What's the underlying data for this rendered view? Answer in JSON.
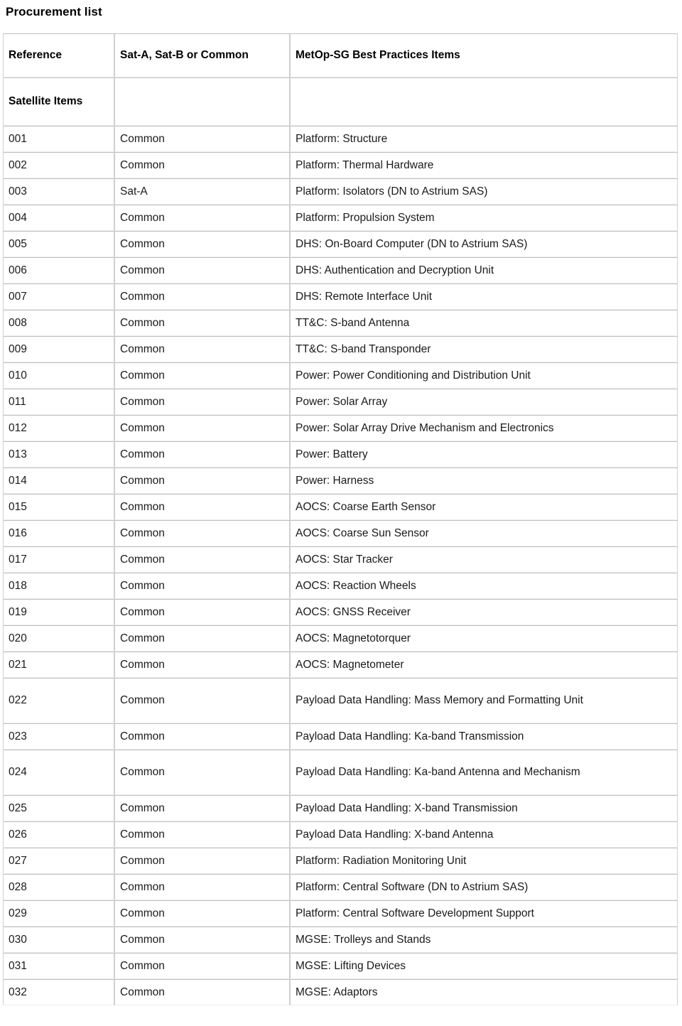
{
  "document": {
    "title": "Procurement list"
  },
  "table": {
    "headers": {
      "reference": "Reference",
      "sat_or_common": "Sat-A, Sat-B or Common",
      "items": "MetOp-SG Best Practices Items"
    },
    "subheader": {
      "reference": "Satellite Items",
      "sat_or_common": "",
      "items": ""
    },
    "columns": [
      "Reference",
      "Sat-A, Sat-B or Common",
      "MetOp-SG Best Practices Items"
    ],
    "rows": [
      {
        "ref": "001",
        "sat": "Common",
        "item": "Platform: Structure"
      },
      {
        "ref": "002",
        "sat": "Common",
        "item": "Platform: Thermal Hardware"
      },
      {
        "ref": "003",
        "sat": "Sat-A",
        "item": "Platform: Isolators (DN to Astrium SAS)"
      },
      {
        "ref": "004",
        "sat": "Common",
        "item": "Platform: Propulsion System"
      },
      {
        "ref": "005",
        "sat": "Common",
        "item": "DHS: On-Board Computer (DN to Astrium SAS)"
      },
      {
        "ref": "006",
        "sat": "Common",
        "item": "DHS: Authentication and Decryption Unit"
      },
      {
        "ref": "007",
        "sat": "Common",
        "item": "DHS: Remote Interface Unit"
      },
      {
        "ref": "008",
        "sat": "Common",
        "item": "TT&C: S-band Antenna"
      },
      {
        "ref": "009",
        "sat": "Common",
        "item": "TT&C: S-band Transponder"
      },
      {
        "ref": "010",
        "sat": "Common",
        "item": "Power: Power Conditioning and Distribution Unit"
      },
      {
        "ref": "011",
        "sat": "Common",
        "item": "Power: Solar Array"
      },
      {
        "ref": "012",
        "sat": "Common",
        "item": "Power: Solar Array Drive Mechanism and Electronics"
      },
      {
        "ref": "013",
        "sat": "Common",
        "item": "Power: Battery"
      },
      {
        "ref": "014",
        "sat": "Common",
        "item": "Power: Harness"
      },
      {
        "ref": "015",
        "sat": "Common",
        "item": "AOCS: Coarse Earth Sensor"
      },
      {
        "ref": "016",
        "sat": "Common",
        "item": "AOCS: Coarse Sun Sensor"
      },
      {
        "ref": "017",
        "sat": "Common",
        "item": "AOCS: Star Tracker"
      },
      {
        "ref": "018",
        "sat": "Common",
        "item": "AOCS: Reaction Wheels"
      },
      {
        "ref": "019",
        "sat": "Common",
        "item": "AOCS: GNSS Receiver"
      },
      {
        "ref": "020",
        "sat": "Common",
        "item": "AOCS: Magnetotorquer"
      },
      {
        "ref": "021",
        "sat": "Common",
        "item": "AOCS: Magnetometer"
      },
      {
        "ref": "022",
        "sat": "Common",
        "item": "Payload Data Handling: Mass Memory and Formatting Unit",
        "tall": true
      },
      {
        "ref": "023",
        "sat": "Common",
        "item": "Payload Data Handling: Ka-band Transmission"
      },
      {
        "ref": "024",
        "sat": "Common",
        "item": "Payload Data Handling: Ka-band Antenna and Mechanism",
        "tall": true
      },
      {
        "ref": "025",
        "sat": "Common",
        "item": "Payload Data Handling: X-band Transmission"
      },
      {
        "ref": "026",
        "sat": "Common",
        "item": "Payload Data Handling: X-band Antenna"
      },
      {
        "ref": "027",
        "sat": "Common",
        "item": "Platform: Radiation Monitoring Unit"
      },
      {
        "ref": "028",
        "sat": "Common",
        "item": "Platform: Central Software (DN to Astrium SAS)"
      },
      {
        "ref": "029",
        "sat": "Common",
        "item": "Platform: Central Software Development Support"
      },
      {
        "ref": "030",
        "sat": "Common",
        "item": "MGSE: Trolleys and Stands"
      },
      {
        "ref": "031",
        "sat": "Common",
        "item": "MGSE: Lifting Devices"
      },
      {
        "ref": "032",
        "sat": "Common",
        "item": "MGSE: Adaptors"
      }
    ]
  },
  "colors": {
    "text": "#1a1a1a",
    "heading": "#000000",
    "border": "#cfcfcf",
    "border_light": "#ededed",
    "background": "#ffffff"
  }
}
